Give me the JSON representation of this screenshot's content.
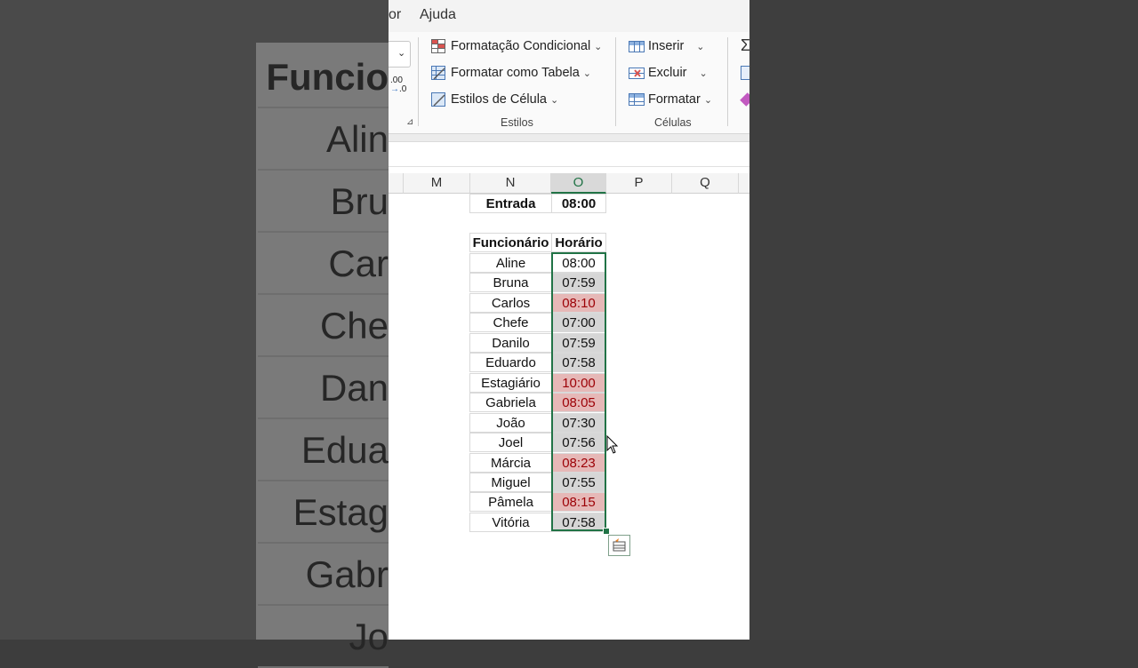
{
  "background_zoom": {
    "header": "Funcio",
    "names": [
      "Alin",
      "Bru",
      "Car",
      "Che",
      "Dan",
      "Edua",
      "Estag",
      "Gabr",
      "Jo"
    ]
  },
  "menu": {
    "partial_item": "or",
    "help": "Ajuda"
  },
  "ribbon": {
    "number_format_dropdown": "",
    "decimal_label": ".00\n.0",
    "styles": {
      "conditional_format": "Formatação Condicional",
      "format_as_table": "Formatar como Tabela",
      "cell_styles": "Estilos de Célula",
      "group_label": "Estilos"
    },
    "cells": {
      "insert": "Inserir",
      "delete": "Excluir",
      "format": "Formatar",
      "group_label": "Células"
    },
    "editing": {
      "sum_icon": "Σ"
    }
  },
  "columns": [
    "M",
    "N",
    "O",
    "P",
    "Q"
  ],
  "selected_column": "O",
  "entrada": {
    "label": "Entrada",
    "value": "08:00"
  },
  "table": {
    "headers": [
      "Funcionário",
      "Horário"
    ],
    "rows": [
      {
        "name": "Aline",
        "time": "08:00",
        "state": "normal"
      },
      {
        "name": "Bruna",
        "time": "07:59",
        "state": "early"
      },
      {
        "name": "Carlos",
        "time": "08:10",
        "state": "late"
      },
      {
        "name": "Chefe",
        "time": "07:00",
        "state": "early"
      },
      {
        "name": "Danilo",
        "time": "07:59",
        "state": "early"
      },
      {
        "name": "Eduardo",
        "time": "07:58",
        "state": "early"
      },
      {
        "name": "Estagiário",
        "time": "10:00",
        "state": "late"
      },
      {
        "name": "Gabriela",
        "time": "08:05",
        "state": "late"
      },
      {
        "name": "João",
        "time": "07:30",
        "state": "early"
      },
      {
        "name": "Joel",
        "time": "07:56",
        "state": "early"
      },
      {
        "name": "Márcia",
        "time": "08:23",
        "state": "late"
      },
      {
        "name": "Miguel",
        "time": "07:55",
        "state": "early"
      },
      {
        "name": "Pâmela",
        "time": "08:15",
        "state": "late"
      },
      {
        "name": "Vitória",
        "time": "07:58",
        "state": "early"
      }
    ]
  },
  "icons": {
    "conditional": "conditional-format-icon",
    "table": "format-table-icon",
    "cellstyle": "cell-style-icon",
    "insert": "insert-cells-icon",
    "delete": "delete-cells-icon",
    "format": "format-cells-icon",
    "quick_analysis": "quick-analysis-icon"
  }
}
